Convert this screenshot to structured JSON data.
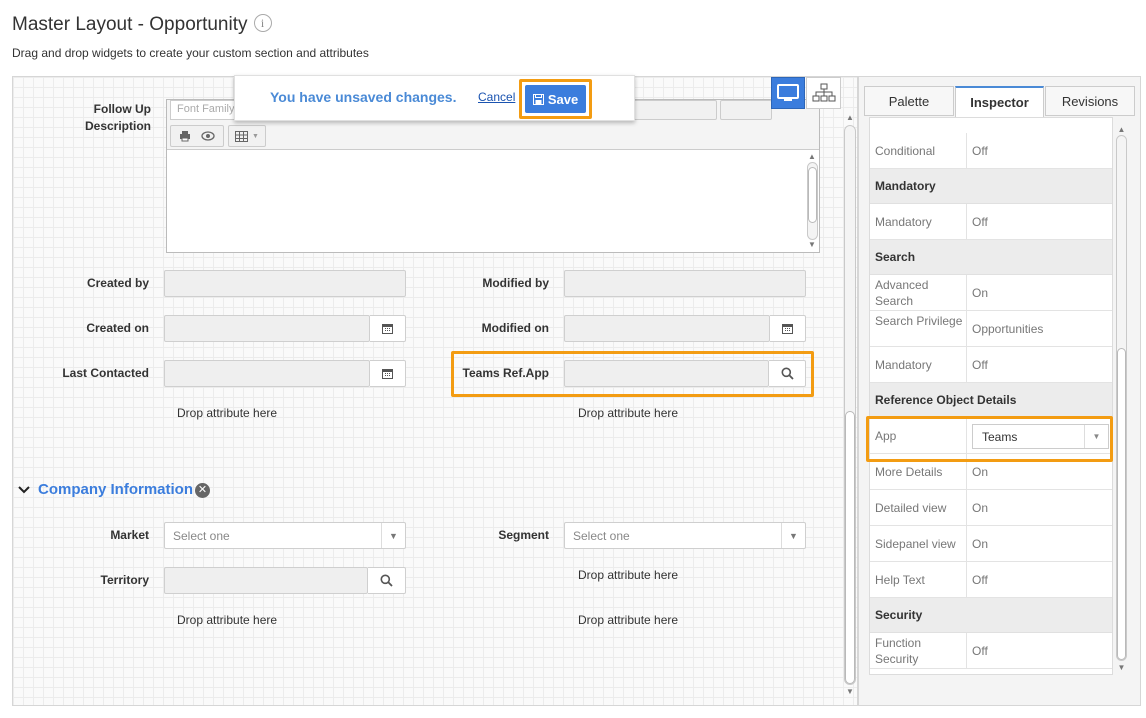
{
  "header": {
    "title": "Master Layout - Opportunity",
    "info_glyph": "i",
    "subtitle": "Drag and drop widgets to create your custom section and attributes"
  },
  "banner": {
    "message": "You have unsaved changes.",
    "cancel_label": "Cancel",
    "save_label": "Save"
  },
  "canvas": {
    "follow_up_label": "Follow Up\nDescription",
    "font_family_placeholder": "Font Family",
    "fields": {
      "created_by": "Created by",
      "modified_by": "Modified by",
      "created_on": "Created on",
      "modified_on": "Modified on",
      "last_contacted": "Last Contacted",
      "teams_ref_app": "Teams Ref.App"
    },
    "drop_here": "Drop attribute here",
    "company_section": {
      "title": "Company Information",
      "fields": {
        "market": "Market",
        "segment": "Segment",
        "territory": "Territory"
      },
      "select_placeholder": "Select one"
    }
  },
  "right_panel": {
    "tabs": [
      "Palette",
      "Inspector",
      "Revisions"
    ],
    "active_tab": "Inspector",
    "rows": [
      {
        "type": "prop",
        "key": "Conditional",
        "value": "Off"
      },
      {
        "type": "section",
        "key": "Mandatory"
      },
      {
        "type": "prop",
        "key": "Mandatory",
        "value": "Off"
      },
      {
        "type": "section",
        "key": "Search"
      },
      {
        "type": "prop",
        "key": "Advanced Search",
        "value": "On"
      },
      {
        "type": "prop",
        "key": "Search Privilege",
        "value": "Opportunities"
      },
      {
        "type": "prop",
        "key": "Mandatory",
        "value": "Off"
      },
      {
        "type": "section",
        "key": "Reference Object Details"
      },
      {
        "type": "select",
        "key": "App",
        "value": "Teams"
      },
      {
        "type": "prop",
        "key": "More Details",
        "value": "On"
      },
      {
        "type": "prop",
        "key": "Detailed view",
        "value": "On"
      },
      {
        "type": "prop",
        "key": "Sidepanel view",
        "value": "On"
      },
      {
        "type": "prop",
        "key": "Help Text",
        "value": "Off"
      },
      {
        "type": "section",
        "key": "Security"
      },
      {
        "type": "prop",
        "key": "Function Security",
        "value": "Off"
      }
    ]
  },
  "colors": {
    "accent": "#3b7ddd",
    "highlight": "#f39c12",
    "banner_text": "#4a8ad6"
  }
}
